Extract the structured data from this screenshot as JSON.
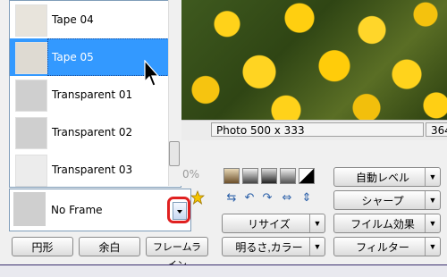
{
  "status_bar": {
    "photo_info": "Photo 500 x 333",
    "right_value": "364"
  },
  "frame_list": {
    "items": [
      {
        "label": "Tape 04",
        "selected": false
      },
      {
        "label": "Tape 05",
        "selected": true
      },
      {
        "label": "Transparent 01",
        "selected": false
      },
      {
        "label": "Transparent 02",
        "selected": false
      },
      {
        "label": "Transparent 03",
        "selected": false
      }
    ]
  },
  "frame_combo": {
    "value": "No Frame"
  },
  "zoom_fragment": "0%",
  "frame_buttons": {
    "circle": "円形",
    "margin": "余白",
    "frame_line": "フレームライン"
  },
  "right_buttons": {
    "auto_level": "自動レベル",
    "sharp": "シャープ",
    "film_effect": "フイルム効果",
    "filter": "フィルター",
    "resize": "リサイズ",
    "brightness_color": "明るさ,カラー"
  },
  "colors": {
    "selection": "#3399ff",
    "highlight_ring": "#e02020",
    "list_border": "#7f9db9"
  }
}
